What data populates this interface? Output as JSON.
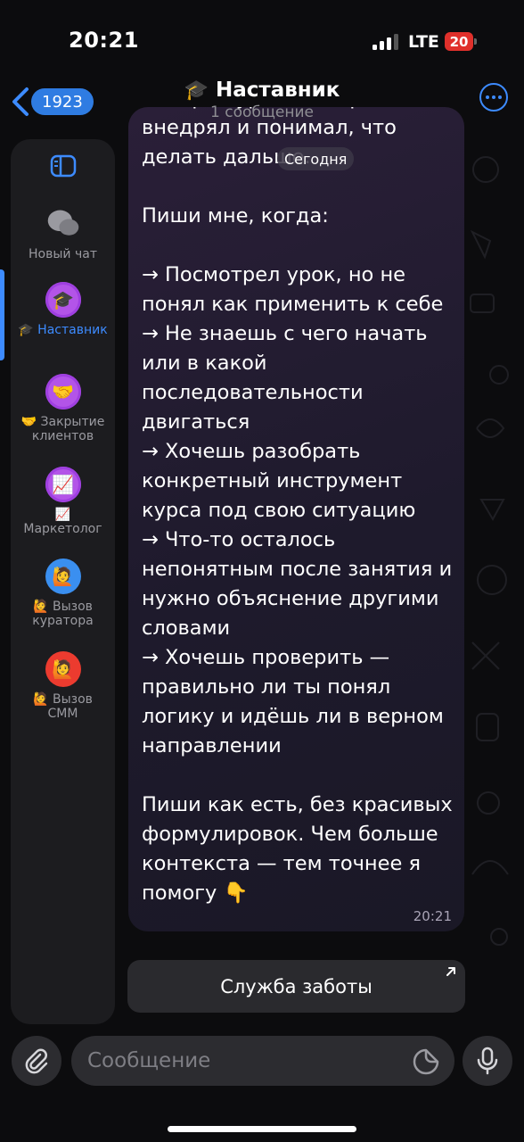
{
  "status_bar": {
    "time": "20:21",
    "network": "LTE",
    "battery": "20",
    "battery_color": "#e0302b"
  },
  "header": {
    "back_count": "1923",
    "title_emoji": "🎓",
    "title": "Наставник",
    "subtitle": "1 сообщение",
    "accent_color": "#3d8bff"
  },
  "sidebar": {
    "top_icon": "sidebar-toggle-icon",
    "folders": [
      {
        "icon": "chat-bubbles-icon",
        "glyph": "💬",
        "label": "Новый чат",
        "active": false
      },
      {
        "icon": "graduation-cap-icon",
        "glyph": "🎓",
        "label": "🎓 Наставник",
        "active": true
      },
      {
        "icon": "handshake-icon",
        "glyph": "🤝",
        "label": "🤝 Закрытие клиентов",
        "active": false
      },
      {
        "icon": "chart-up-icon",
        "glyph": "📈",
        "label": "📈 Маркетолог",
        "active": false
      },
      {
        "icon": "person-raising-hand-icon",
        "glyph": "🙋",
        "label": "🙋 Вызов куратора",
        "active": false
      },
      {
        "icon": "person-raising-hand-icon",
        "glyph": "🙋",
        "label": "🙋 Вызов СММ",
        "active": false
      }
    ]
  },
  "message": {
    "date_label": "Сегодня",
    "text": "смотрел уроки — а реально внедрял и понимал, что делать дальше.\n\nПиши мне, когда:\n\n→ Посмотрел урок, но не понял как применить к себе\n→ Не знаешь с чего начать или в какой последовательности двигаться\n→ Хочешь разобрать конкретный инструмент курса под свою ситуацию\n→ Что-то осталось непонятным после занятия и нужно объяснение другими словами\n→ Хочешь проверить — правильно ли ты понял логику и идёшь ли в верном направлении\n\nПиши как есть, без красивых формулировок. Чем больше контекста — тем точнее я помогу 👇",
    "time": "20:21"
  },
  "inline_keyboard": {
    "button_label": "Служба заботы"
  },
  "composer": {
    "placeholder": "Сообщение"
  }
}
